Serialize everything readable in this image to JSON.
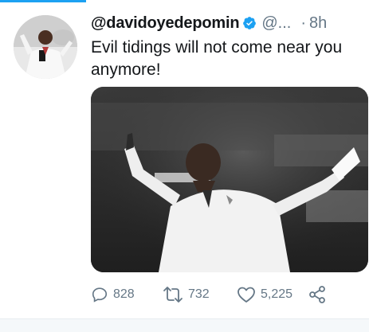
{
  "tweet": {
    "handle": "@davidoyedepomin",
    "screen_name": "@...",
    "separator": "·",
    "time": "8h",
    "text": "Evil tidings will not come near you anymore!",
    "verified": true
  },
  "actions": {
    "reply_count": "828",
    "retweet_count": "732",
    "like_count": "5,225"
  },
  "icons": {
    "verified": "verified-badge-icon",
    "reply": "reply-icon",
    "retweet": "retweet-icon",
    "like": "heart-icon",
    "share": "share-icon",
    "more": "chevron-down-icon"
  },
  "colors": {
    "accent": "#1da1f2",
    "text": "#14171a",
    "muted": "#657786"
  }
}
